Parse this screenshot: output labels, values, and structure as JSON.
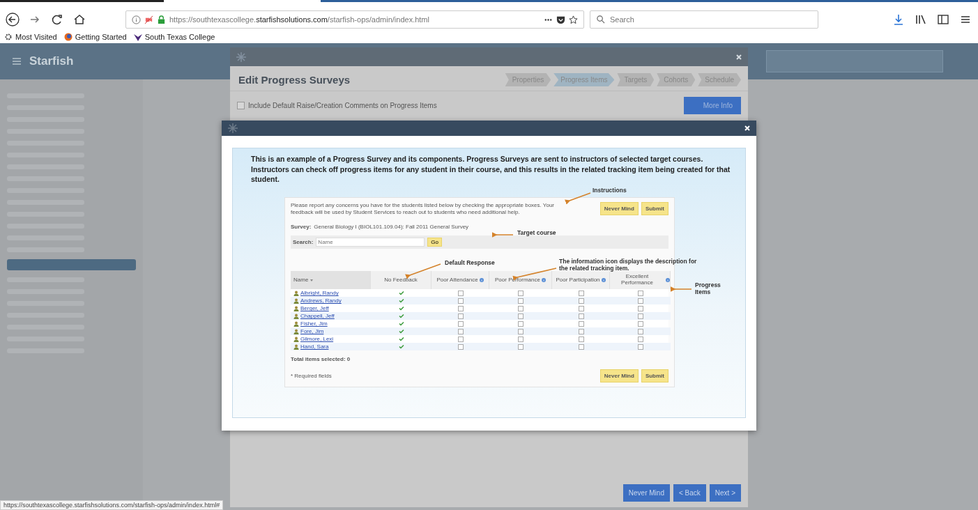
{
  "browser": {
    "url": "https://southtexascollege.**starfishsolutions.com**/starfish-ops/admin/index.html",
    "search_placeholder": "Search",
    "bookmarks": [
      {
        "kind": "gear",
        "label": "Most Visited"
      },
      {
        "kind": "globe",
        "label": "Getting Started"
      },
      {
        "kind": "flag",
        "label": "South Texas College"
      }
    ]
  },
  "app": {
    "name": "Starfish"
  },
  "wizard_dialog": {
    "title": "Edit Progress Surveys",
    "steps": [
      {
        "label": "Properties",
        "selected": false
      },
      {
        "label": "Progress Items",
        "selected": true
      },
      {
        "label": "Targets",
        "selected": false
      },
      {
        "label": "Cohorts",
        "selected": false
      },
      {
        "label": "Schedule",
        "selected": false
      }
    ],
    "include_comments": {
      "label": "Include Default Raise/Creation Comments on Progress Items",
      "checked": false
    },
    "more_info_button": "More Info",
    "footer_buttons": [
      "Never Mind",
      "< Back",
      "Next >"
    ]
  },
  "example_dialog": {
    "description": "This is an example of a Progress Survey and its components. Progress Surveys are sent to instructors of selected target courses. Instructors can check off progress items for any student in their course, and this results in the related tracking item being created for that student.",
    "example": {
      "instructions": "Please report any concerns you have for the students listed below by checking the appropriate boxes. Your feedback will be used by Student Services to reach out to students who need additional help.",
      "top_buttons": [
        "Never Mind",
        "Submit"
      ],
      "survey_label": "Survey:",
      "survey_value": "General Biology I (BIOL101.109.04): Fall 2011 General Survey",
      "search_label": "Search:",
      "search_placeholder": "Name",
      "go_button": "Go",
      "columns": [
        {
          "label": "Name",
          "info": false
        },
        {
          "label": "No Feedback",
          "info": false
        },
        {
          "label": "Poor Attendance",
          "info": true
        },
        {
          "label": "Poor Performance",
          "info": true
        },
        {
          "label": "Poor Participation",
          "info": true
        },
        {
          "label": "Excellent Performance",
          "info": true
        }
      ],
      "rows": [
        {
          "name": "Albright, Randy",
          "no_feedback": true,
          "checks": [
            false,
            false,
            false,
            false
          ]
        },
        {
          "name": "Andrews, Randy",
          "no_feedback": true,
          "checks": [
            false,
            false,
            false,
            false
          ]
        },
        {
          "name": "Berger, Jeff",
          "no_feedback": true,
          "checks": [
            false,
            false,
            false,
            false
          ]
        },
        {
          "name": "Chappell, Jeff",
          "no_feedback": true,
          "checks": [
            false,
            false,
            false,
            false
          ]
        },
        {
          "name": "Fisher, Jim",
          "no_feedback": true,
          "checks": [
            false,
            false,
            false,
            false
          ]
        },
        {
          "name": "Fore, Jim",
          "no_feedback": true,
          "checks": [
            false,
            false,
            false,
            false
          ]
        },
        {
          "name": "Gilmore, Lexi",
          "no_feedback": true,
          "checks": [
            false,
            false,
            false,
            false
          ]
        },
        {
          "name": "Hand, Sara",
          "no_feedback": true,
          "checks": [
            false,
            false,
            false,
            false
          ]
        }
      ],
      "total_selected": "Total items selected: 0",
      "required_note": "* Required fields",
      "bottom_buttons": [
        "Never Mind",
        "Submit"
      ]
    },
    "annotations": [
      {
        "kind": "instructions",
        "text": "Instructions"
      },
      {
        "kind": "target",
        "text": "Target course"
      },
      {
        "kind": "default",
        "text": "Default Response"
      },
      {
        "kind": "info",
        "text": "The information icon displays the description for the related tracking item."
      },
      {
        "kind": "items",
        "text": "Progress Items"
      }
    ]
  },
  "status_url": "https://southtexascollege.starfishsolutions.com/starfish-ops/admin/index.html#"
}
